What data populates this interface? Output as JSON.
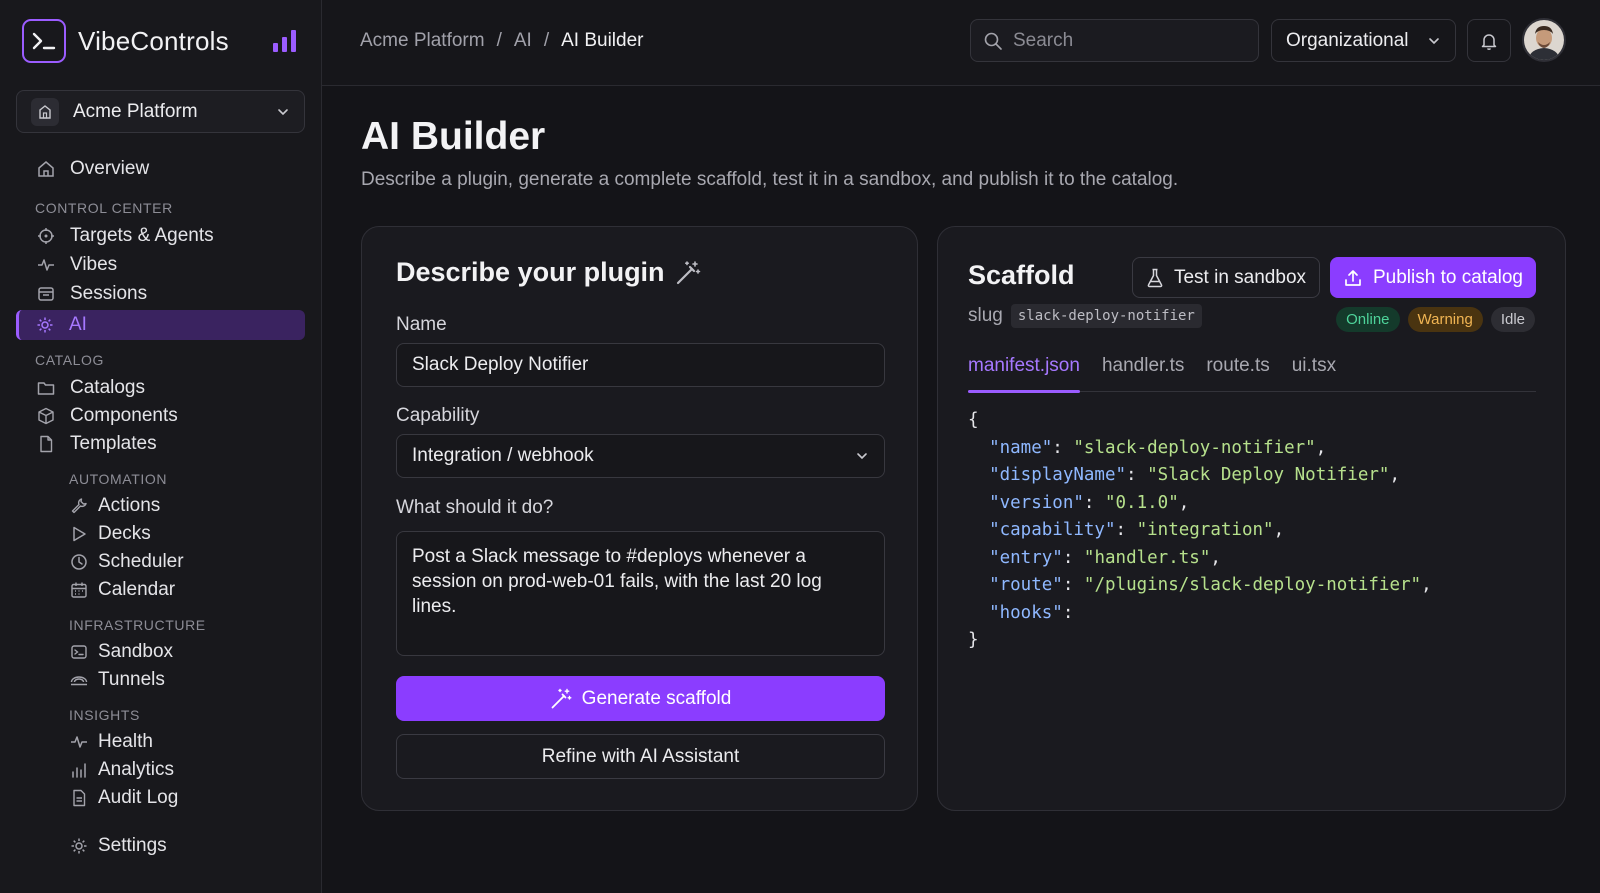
{
  "brand": {
    "name": "VibeControls"
  },
  "workspace": {
    "label": "Acme Platform"
  },
  "nav": {
    "overview": "Overview",
    "control_center_label": "CONTROL CENTER",
    "targets": "Targets & Agents",
    "vibes": "Vibes",
    "sessions": "Sessions",
    "ai": "AI",
    "catalog_label": "CATALOG",
    "catalogs": "Catalogs",
    "components": "Components",
    "templates": "Templates",
    "automation_label": "AUTOMATION",
    "actions": "Actions",
    "decks": "Decks",
    "scheduler": "Scheduler",
    "calendar": "Calendar",
    "infrastructure_label": "INFRASTRUCTURE",
    "sandbox": "Sandbox",
    "tunnels": "Tunnels",
    "insights_label": "INSIGHTS",
    "health": "Health",
    "analytics": "Analytics",
    "audit_log": "Audit Log",
    "settings": "Settings"
  },
  "topbar": {
    "breadcrumb": [
      "Acme Platform",
      "/",
      "AI",
      "/",
      "AI Builder"
    ],
    "search_placeholder": "Search",
    "org_select": "Organizational"
  },
  "page": {
    "title": "AI Builder",
    "subtitle": "Describe a plugin, generate a complete scaffold, test it in a sandbox, and publish it to the catalog."
  },
  "describe": {
    "title": "Describe your plugin",
    "name_label": "Name",
    "name_value": "Slack Deploy Notifier",
    "capability_label": "Capability",
    "capability_value": "Integration / webhook",
    "what_label": "What should it do?",
    "what_value": "Post a Slack message to #deploys whenever a session on prod-web-01 fails, with the last 20 log lines.",
    "generate_button": "Generate scaffold",
    "refine_button": "Refine with AI Assistant"
  },
  "scaffold": {
    "title": "Scaffold",
    "test_button": "Test in sandbox",
    "publish_button": "Publish to catalog",
    "slug_label": "slug",
    "slug_value": "slack-deploy-notifier",
    "badges": [
      "Online",
      "Warning",
      "Idle"
    ],
    "tabs": [
      "manifest.json",
      "handler.ts",
      "route.ts",
      "ui.tsx"
    ],
    "code": {
      "open": "{",
      "lines": [
        {
          "key": "\"name\"",
          "value": "\"slack-deploy-notifier\"",
          "trail": ","
        },
        {
          "key": "\"displayName\"",
          "value": "\"Slack Deploy Notifier\"",
          "trail": ","
        },
        {
          "key": "\"version\"",
          "value": "\"0.1.0\"",
          "trail": ","
        },
        {
          "key": "\"capability\"",
          "value": "\"integration\"",
          "trail": ","
        },
        {
          "key": "\"entry\"",
          "value": "\"handler.ts\"",
          "trail": ","
        },
        {
          "key": "\"route\"",
          "value": "\"/plugins/slack-deploy-notifier\"",
          "trail": ","
        },
        {
          "key": "\"hooks\"",
          "value": "",
          "trail": ""
        }
      ],
      "close": "}"
    }
  },
  "colors": {
    "accent": "#8b3dff",
    "background": "#141418",
    "online": "#4ed39a",
    "warning": "#f1b553"
  },
  "icons": [
    "terminal-icon",
    "bar-chart-icon",
    "building-icon",
    "chevron-down-icon",
    "home-icon",
    "crosshair-icon",
    "activity-icon",
    "window-icon",
    "cog-icon",
    "folder-icon",
    "cube-icon",
    "file-icon",
    "wrench-icon",
    "play-icon",
    "clock-icon",
    "calendar-icon",
    "console-icon",
    "tunnel-icon",
    "pulse-icon",
    "analytics-icon",
    "document-icon",
    "settings-icon",
    "search-icon",
    "bell-icon",
    "magic-wand-icon",
    "flask-icon",
    "upload-icon"
  ]
}
